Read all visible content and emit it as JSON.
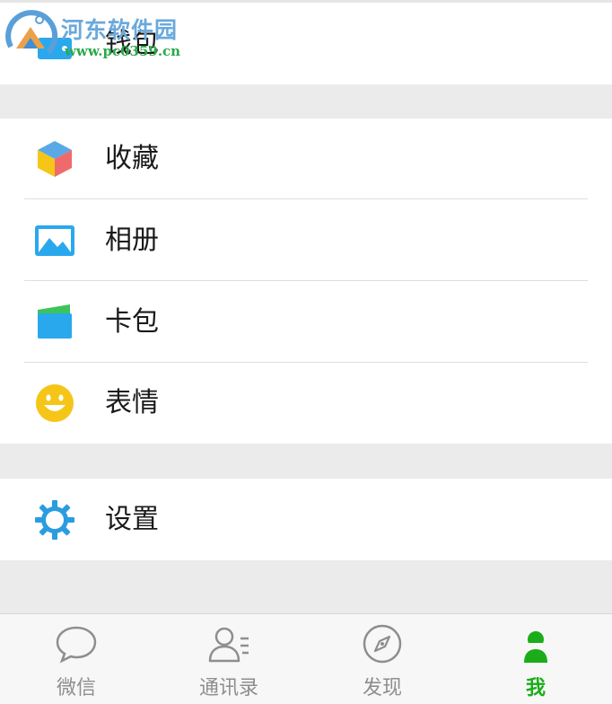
{
  "watermark": {
    "title": "河东软件园",
    "url": "www.pc0359.cn"
  },
  "wallet": {
    "label": "钱包",
    "icon": "wallet-icon"
  },
  "menu": {
    "favorites": {
      "label": "收藏",
      "icon": "cube-icon",
      "color": "#f5c518"
    },
    "album": {
      "label": "相册",
      "icon": "picture-icon",
      "color": "#2aa8ee"
    },
    "cards": {
      "label": "卡包",
      "icon": "card-wallet-icon",
      "color": "#2aa8ee"
    },
    "stickers": {
      "label": "表情",
      "icon": "smiley-icon",
      "color": "#f5c518"
    },
    "settings": {
      "label": "设置",
      "icon": "gear-icon",
      "color": "#2a9de0"
    }
  },
  "tabbar": {
    "tabs": [
      {
        "label": "微信",
        "icon": "chat-bubble-icon",
        "active": false
      },
      {
        "label": "通讯录",
        "icon": "contacts-icon",
        "active": false
      },
      {
        "label": "发现",
        "icon": "compass-icon",
        "active": false
      },
      {
        "label": "我",
        "icon": "person-icon",
        "active": true
      }
    ],
    "active_color": "#1aad19",
    "inactive_color": "#8e8e8e"
  }
}
